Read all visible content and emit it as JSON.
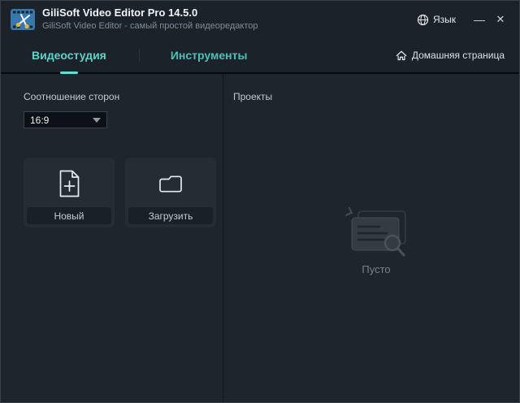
{
  "window": {
    "title": "GiliSoft Video Editor Pro 14.5.0",
    "subtitle": "GiliSoft Video Editor - самый простой видеоредактор",
    "language_label": "Язык",
    "minimize_label": "—",
    "close_label": "✕"
  },
  "tabs": [
    {
      "label": "Видеостудия",
      "active": true
    },
    {
      "label": "Инструменты",
      "active": false
    }
  ],
  "home_link": {
    "label": "Домашняя страница"
  },
  "left_panel": {
    "aspect_ratio_label": "Соотношение сторон",
    "aspect_ratio_value": "16:9",
    "new_button_label": "Новый",
    "load_button_label": "Загрузить"
  },
  "right_panel": {
    "header": "Проекты",
    "empty_label": "Пусто"
  },
  "icons": {
    "logo": "filmstrip-scissors",
    "language": "globe-icon",
    "home": "home-icon",
    "new": "document-plus-icon",
    "load": "folder-icon",
    "empty": "documents-search-illustration"
  },
  "colors": {
    "accent_teal": "#5fd2c9",
    "titlebar_background": "#1c222a",
    "content_background": "#1f252d",
    "card_background": "#262c34",
    "logo_blue": "#3779ad",
    "logo_yellow": "#e8b33a"
  }
}
